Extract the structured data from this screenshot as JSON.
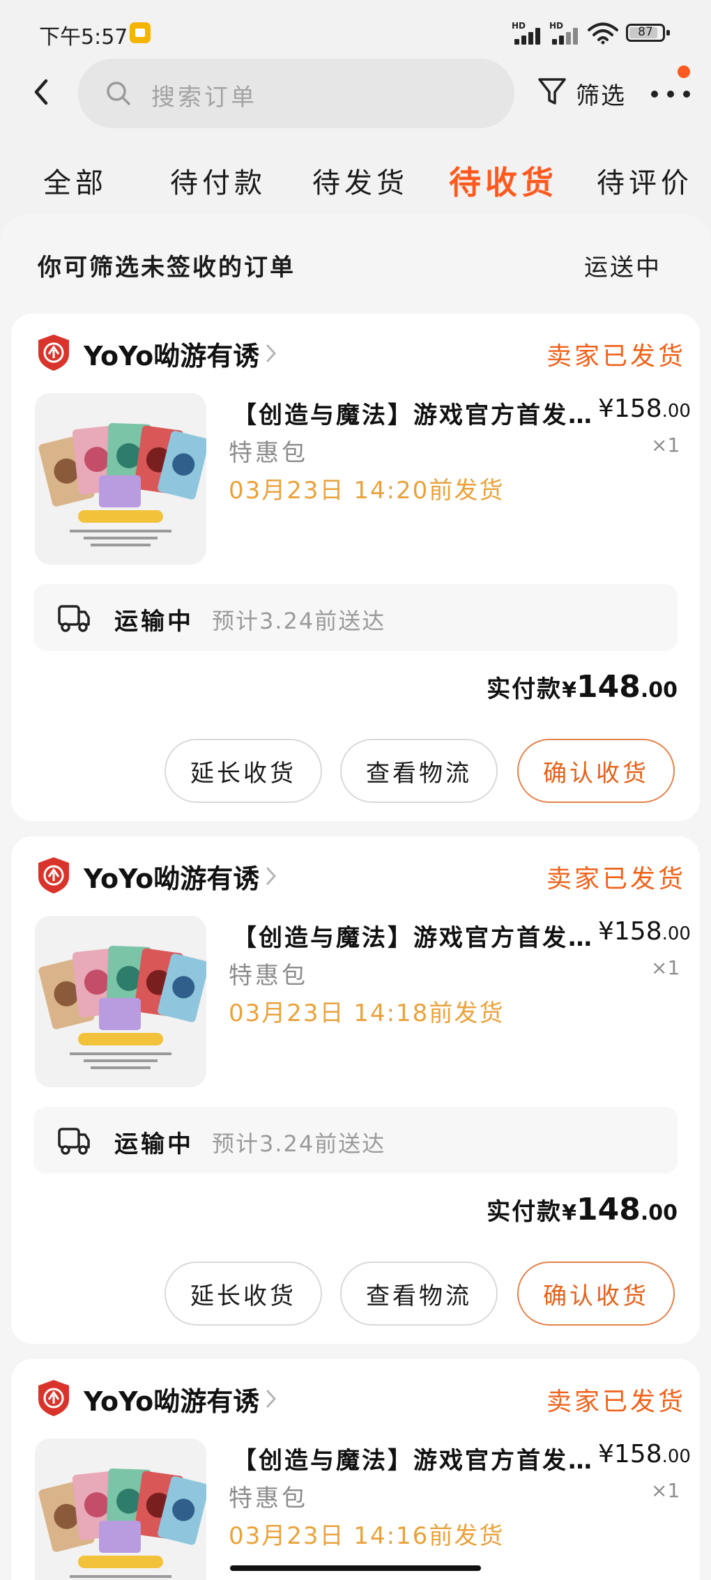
{
  "status_bar": {
    "time": "下午5:57",
    "signal1_label": "HD",
    "signal2_label": "HD",
    "battery": "87",
    "battery_level": 0.87
  },
  "header": {
    "search_placeholder": "搜索订单",
    "filter_label": "筛选"
  },
  "tabs": [
    {
      "label": "全部",
      "active": false
    },
    {
      "label": "待付款",
      "active": false
    },
    {
      "label": "待发货",
      "active": false
    },
    {
      "label": "待收货",
      "active": true
    },
    {
      "label": "待评价",
      "active": false
    }
  ],
  "filter_hint": {
    "text": "你可筛选未签收的订单",
    "status": "运送中"
  },
  "orders": [
    {
      "shop_name": "YoYo呦游有诱",
      "status": "卖家已发货",
      "product_title": "【创造与魔法】游戏官方首发卡牌",
      "price_int": "¥158",
      "price_cents": ".00",
      "variant": "特惠包",
      "quantity": "×1",
      "ship_deadline": "03月23日 14:20前发货",
      "logistics_status": "运输中",
      "logistics_eta": "预计3.24前送达",
      "paid_label": "实付款",
      "paid_currency": "¥",
      "paid_int": "148",
      "paid_cents": ".00",
      "buttons": [
        "延长收货",
        "查看物流",
        "确认收货"
      ]
    },
    {
      "shop_name": "YoYo呦游有诱",
      "status": "卖家已发货",
      "product_title": "【创造与魔法】游戏官方首发卡牌",
      "price_int": "¥158",
      "price_cents": ".00",
      "variant": "特惠包",
      "quantity": "×1",
      "ship_deadline": "03月23日 14:18前发货",
      "logistics_status": "运输中",
      "logistics_eta": "预计3.24前送达",
      "paid_label": "实付款",
      "paid_currency": "¥",
      "paid_int": "148",
      "paid_cents": ".00",
      "buttons": [
        "延长收货",
        "查看物流",
        "确认收货"
      ]
    },
    {
      "shop_name": "YoYo呦游有诱",
      "status": "卖家已发货",
      "product_title": "【创造与魔法】游戏官方首发卡牌",
      "price_int": "¥158",
      "price_cents": ".00",
      "variant": "特惠包",
      "quantity": "×1",
      "ship_deadline": "03月23日 14:16前发货"
    }
  ],
  "colors": {
    "accent": "#ff5a1f",
    "status_orange": "#f0621a",
    "deadline_gold": "#e9a23b",
    "brand_badge_red": "#d9342b"
  },
  "icons": [
    "search-icon",
    "filter-icon",
    "more-icon",
    "back-icon",
    "truck-icon",
    "shop-badge-icon",
    "chevron-right-icon"
  ]
}
